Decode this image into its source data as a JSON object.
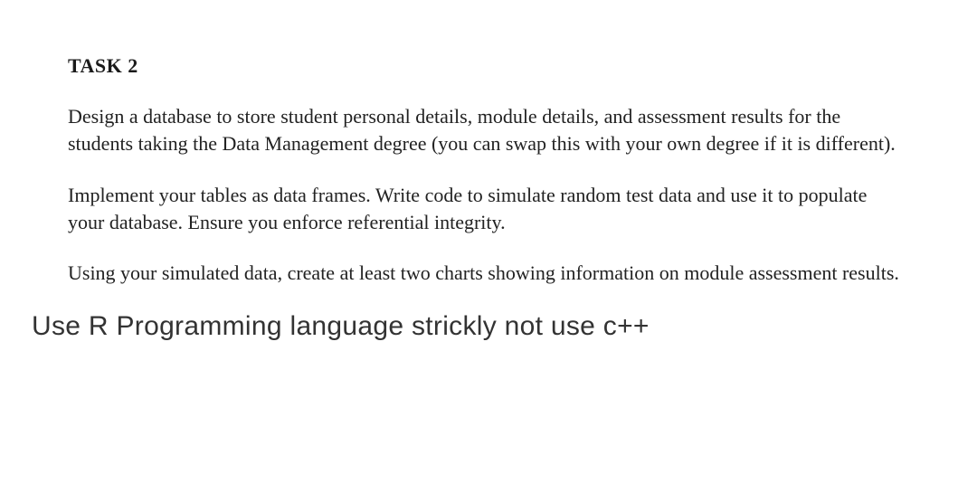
{
  "task": {
    "heading": "TASK 2",
    "paragraphs": [
      "Design a database to store student personal details, module details, and assessment results for the students taking the Data Management degree (you can swap this with your own degree if it is different).",
      "Implement your tables as data frames. Write code to simulate random test data and use it to populate your database. Ensure you enforce referential integrity.",
      "Using your simulated data, create at least two charts showing information on module assessment results."
    ]
  },
  "instruction": "Use R Programming language strickly not use c++"
}
